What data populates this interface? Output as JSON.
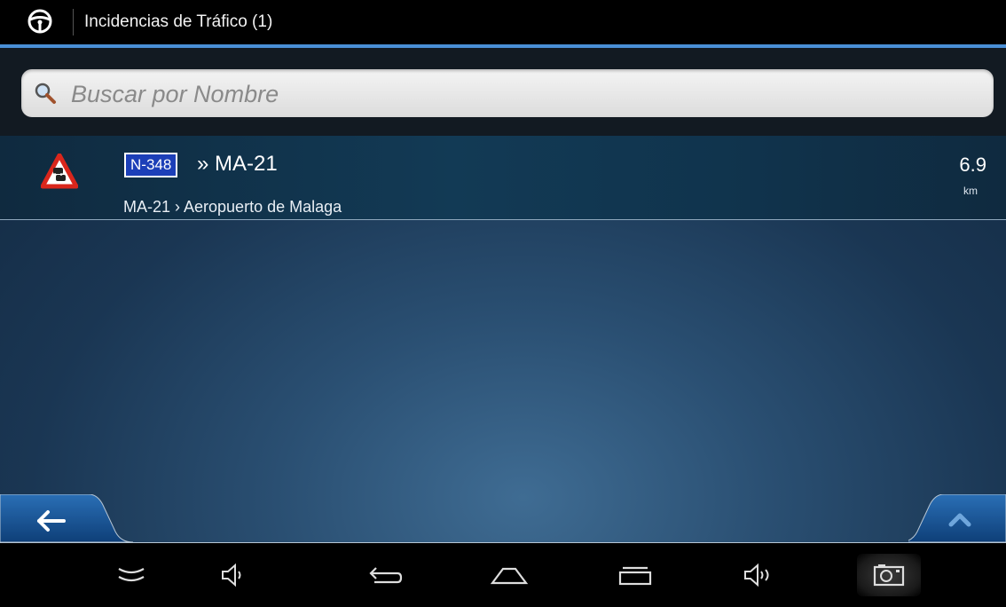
{
  "header": {
    "title": "Incidencias de Tráfico (1)",
    "app_icon": "steering-wheel-icon"
  },
  "search": {
    "placeholder": "Buscar por Nombre",
    "value": ""
  },
  "incidents": [
    {
      "icon": "traffic-jam-warning-icon",
      "road_badge": "N-348",
      "title": "» MA-21",
      "subtitle": "MA-21 › Aeropuerto de Malaga",
      "distance": "6.9",
      "unit": "km"
    }
  ],
  "bottom": {
    "back_icon": "arrow-left-icon",
    "up_icon": "chevron-up-icon"
  },
  "navbar": {
    "buttons": [
      "collapse-icon",
      "volume-down-icon",
      "back-icon",
      "home-icon",
      "recent-apps-icon",
      "volume-up-icon",
      "screenshot-icon"
    ]
  },
  "colors": {
    "accent_line": "#4a8fd6",
    "badge_blue": "#1c3fb8",
    "warning_red": "#d9261c"
  }
}
